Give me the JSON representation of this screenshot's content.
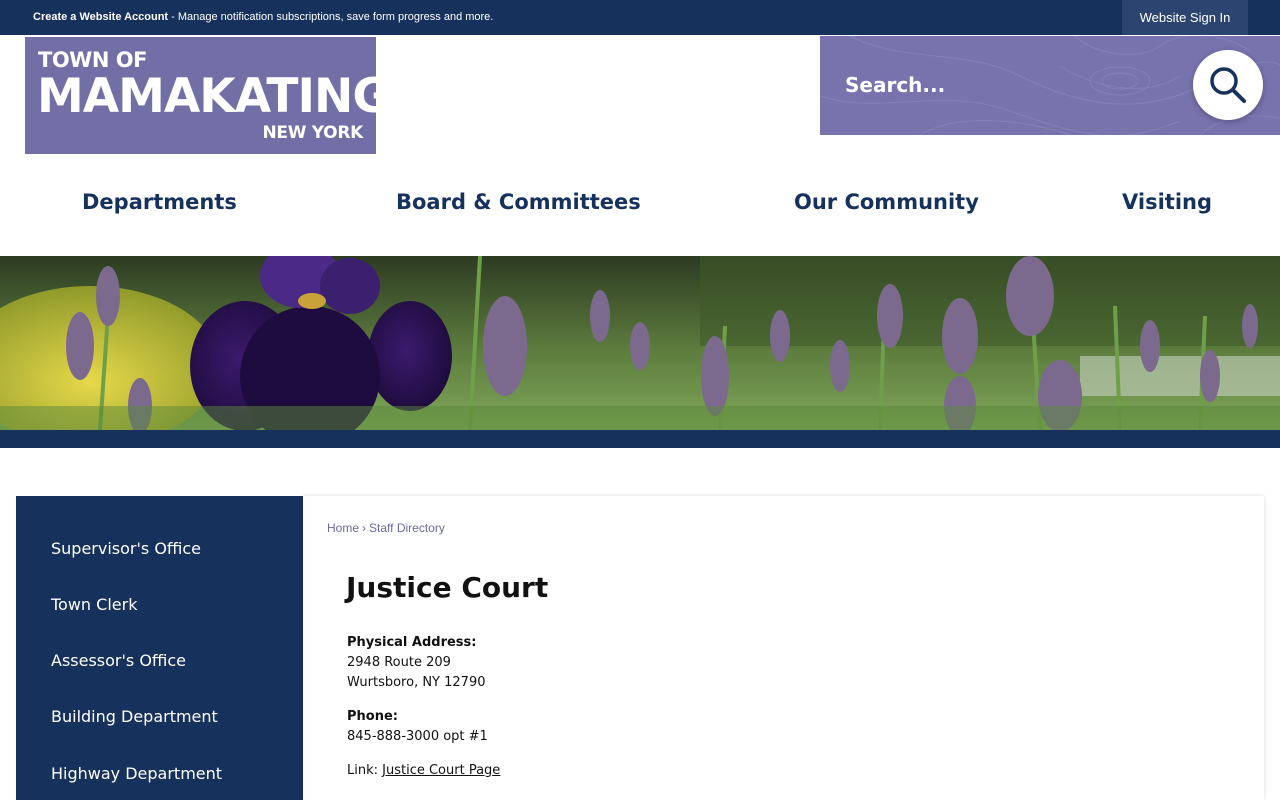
{
  "topbar": {
    "create_account_link": "Create a Website Account",
    "create_account_desc": " - Manage notification subscriptions, save form progress and more.",
    "sign_in": "Website Sign In"
  },
  "logo": {
    "line1": "TOWN OF",
    "line2": "MAMAKATING",
    "line3": "NEW YORK"
  },
  "search": {
    "placeholder": "Search...",
    "icon": "search-icon"
  },
  "nav": {
    "items": [
      {
        "label": "Departments"
      },
      {
        "label": "Board & Committees"
      },
      {
        "label": "Our Community"
      },
      {
        "label": "Visiting"
      }
    ]
  },
  "sidebar": {
    "items": [
      {
        "label": "Supervisor's Office"
      },
      {
        "label": "Town Clerk"
      },
      {
        "label": "Assessor's Office"
      },
      {
        "label": "Building Department"
      },
      {
        "label": "Highway Department"
      }
    ]
  },
  "breadcrumb": {
    "home": "Home",
    "separator": "›",
    "current": "Staff Directory"
  },
  "page": {
    "title": "Justice Court",
    "address_label": "Physical Address:",
    "address_line1": "2948 Route 209",
    "address_line2": "Wurtsboro, NY 12790",
    "phone_label": "Phone:",
    "phone": "845-888-3000 opt #1",
    "link_label": "Link: ",
    "link_text": "Justice Court Page"
  },
  "colors": {
    "navy": "#16325c",
    "purple": "#726fa6",
    "search_bg": "#7872ad"
  }
}
